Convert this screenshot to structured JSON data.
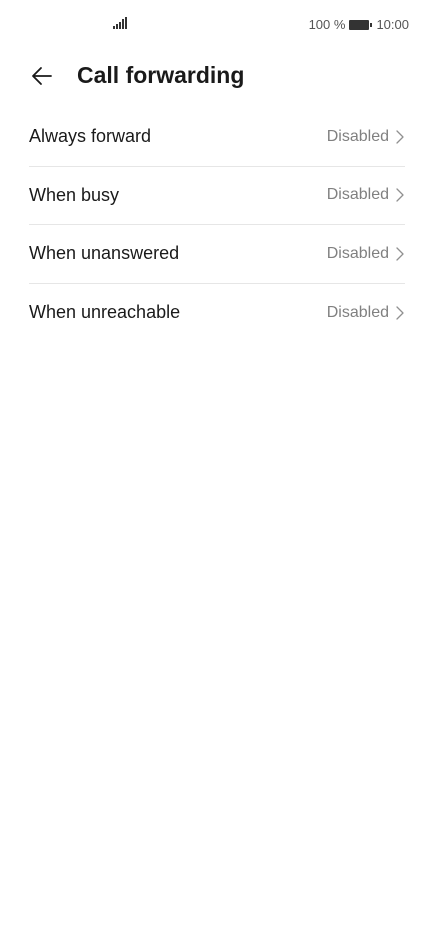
{
  "status_bar": {
    "battery_percent": "100 %",
    "time": "10:00",
    "icons": [
      "signal-icon",
      "battery-icon"
    ]
  },
  "header": {
    "title": "Call forwarding",
    "back_icon": "back-arrow-icon"
  },
  "items": [
    {
      "label": "Always forward",
      "status": "Disabled"
    },
    {
      "label": "When busy",
      "status": "Disabled"
    },
    {
      "label": "When unanswered",
      "status": "Disabled"
    },
    {
      "label": "When unreachable",
      "status": "Disabled"
    }
  ],
  "colors": {
    "background": "#ffffff",
    "text_primary": "#1a1a1a",
    "text_secondary": "#808080",
    "divider": "#e6e6e6"
  }
}
